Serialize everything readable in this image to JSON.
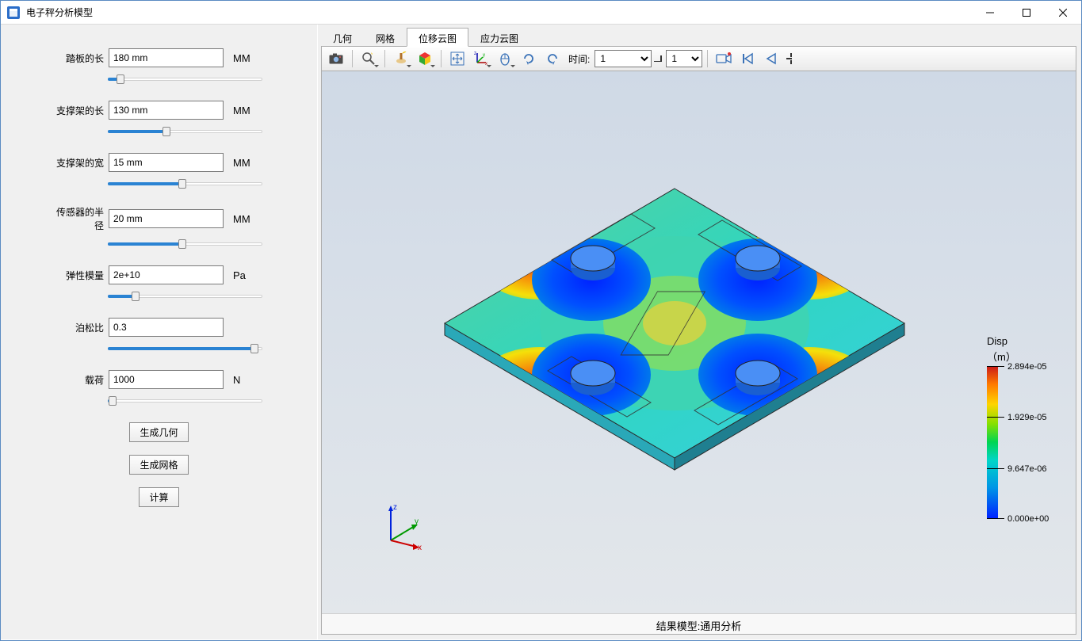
{
  "window": {
    "title": "电子秤分析模型"
  },
  "sidebar": {
    "params": [
      {
        "label": "踏板的长",
        "value": "180 mm",
        "unit": "MM",
        "fill_pct": 8
      },
      {
        "label": "支撑架的长",
        "value": "130 mm",
        "unit": "MM",
        "fill_pct": 38
      },
      {
        "label": "支撑架的宽",
        "value": "15 mm",
        "unit": "MM",
        "fill_pct": 48
      },
      {
        "label": "传感器的半径",
        "value": "20 mm",
        "unit": "MM",
        "fill_pct": 48
      },
      {
        "label": "弹性模量",
        "value": "2e+10",
        "unit": "Pa",
        "fill_pct": 18
      },
      {
        "label": "泊松比",
        "value": "0.3",
        "unit": "",
        "fill_pct": 95
      },
      {
        "label": "载荷",
        "value": "1000",
        "unit": "N",
        "fill_pct": 3
      }
    ],
    "buttons": {
      "gen_geom": "生成几何",
      "gen_mesh": "生成网格",
      "compute": "计算"
    }
  },
  "tabs": [
    {
      "label": "几何",
      "active": false
    },
    {
      "label": "网格",
      "active": false
    },
    {
      "label": "位移云图",
      "active": true
    },
    {
      "label": "应力云图",
      "active": false
    }
  ],
  "toolbar": {
    "time_label": "时间:",
    "time1_value": "1",
    "time2_value": "1"
  },
  "legend": {
    "title_l1": "Disp",
    "title_l2": "（m）",
    "ticks": [
      {
        "pos_pct": 0,
        "label": "2.894e-05"
      },
      {
        "pos_pct": 33,
        "label": "1.929e-05"
      },
      {
        "pos_pct": 67,
        "label": "9.647e-06"
      },
      {
        "pos_pct": 100,
        "label": "0.000e+00"
      }
    ]
  },
  "viewport": {
    "caption": "结果模型:通用分析"
  },
  "axes": {
    "z": "z",
    "y": "y",
    "x": "x"
  }
}
